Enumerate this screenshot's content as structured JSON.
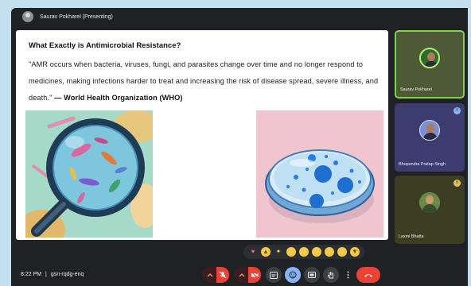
{
  "presenter_bar": {
    "label": "Saurav Pokharel (Presenting)"
  },
  "slide": {
    "title": "What Exactly is Antimicrobial Resistance?",
    "quote": "\"AMR occurs when bacteria, viruses, fungi, and parasites change over time and no longer respond to medicines, making infections harder to treat and increasing the risk of disease spread, severe illness, and death.\"",
    "attribution": "— World Health Organization (WHO)",
    "images": [
      {
        "icon": "magnifying-glass-bacteria-illustration"
      },
      {
        "icon": "petri-dish-illustration"
      }
    ]
  },
  "participants": [
    {
      "name": "Saurav Pokharel",
      "speaking": true
    },
    {
      "name": "Bhupendra Pratap Singh",
      "speaking": false
    },
    {
      "name": "Laxmi Bhatta",
      "speaking": false
    }
  ],
  "reactions": [
    "heart",
    "thumbs-up",
    "party-popper",
    "clapping-hands",
    "laughing",
    "surprised",
    "crying",
    "thinking",
    "thumbs-down"
  ],
  "bottom_bar": {
    "time": "8:22 PM",
    "separator": "|",
    "meeting_code": "gsn-rqdg-enq"
  },
  "colors": {
    "background": "#202124",
    "hangup_red": "#ea4335",
    "active_blue": "#8ab4f8",
    "speaking_border": "#7fd34a"
  }
}
